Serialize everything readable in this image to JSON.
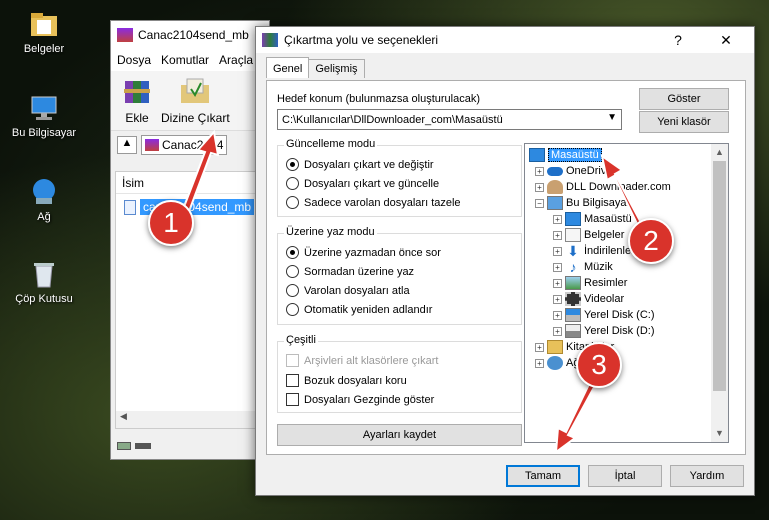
{
  "desktop": {
    "icons": [
      {
        "label": "Belgeler"
      },
      {
        "label": "Bu Bilgisayar"
      },
      {
        "label": "Ağ"
      },
      {
        "label": "Çöp Kutusu"
      }
    ]
  },
  "winrar": {
    "title": "Canac2104send_mb",
    "menu": [
      "Dosya",
      "Komutlar",
      "Araçla"
    ],
    "toolbar": {
      "add": "Ekle",
      "extract_to": "Dizine Çıkart"
    },
    "path": "Canac2104",
    "list_header": "İsim",
    "file": "canac2104send_mb"
  },
  "dialog": {
    "title": "Çıkartma yolu ve seçenekleri",
    "help": "?",
    "close": "✕",
    "tabs": [
      "Genel",
      "Gelişmiş"
    ],
    "destination_label": "Hedef konum (bulunmazsa oluşturulacak)",
    "destination_value": "C:\\Kullanıcılar\\DllDownloader_com\\Masaüstü",
    "show_button": "Göster",
    "new_folder_button": "Yeni klasör",
    "update_mode": {
      "title": "Güncelleme modu",
      "options": [
        "Dosyaları çıkart ve değiştir",
        "Dosyaları çıkart ve güncelle",
        "Sadece varolan dosyaları tazele"
      ],
      "selected": 0
    },
    "overwrite_mode": {
      "title": "Üzerine yaz modu",
      "options": [
        "Üzerine yazmadan önce sor",
        "Sormadan üzerine yaz",
        "Varolan dosyaları atla",
        "Otomatik yeniden adlandır"
      ],
      "selected": 0
    },
    "misc": {
      "title": "Çeşitli",
      "options": [
        "Arşivleri alt klasörlere çıkart",
        "Bozuk dosyaları koru",
        "Dosyaları Gezginde göster"
      ]
    },
    "save_settings": "Ayarları kaydet",
    "tree": [
      {
        "label": "Masaüstü",
        "level": 0,
        "selected": true
      },
      {
        "label": "OneDrive",
        "level": 1
      },
      {
        "label": "DLL Downloader.com",
        "level": 1
      },
      {
        "label": "Bu Bilgisayar",
        "level": 1
      },
      {
        "label": "Masaüstü",
        "level": 2
      },
      {
        "label": "Belgeler",
        "level": 2
      },
      {
        "label": "İndirilenler",
        "level": 2
      },
      {
        "label": "Müzik",
        "level": 2
      },
      {
        "label": "Resimler",
        "level": 2
      },
      {
        "label": "Videolar",
        "level": 2
      },
      {
        "label": "Yerel Disk (C:)",
        "level": 2
      },
      {
        "label": "Yerel Disk (D:)",
        "level": 2
      },
      {
        "label": "Kitaplıklar",
        "level": 1
      },
      {
        "label": "Ağ",
        "level": 1
      }
    ],
    "buttons": {
      "ok": "Tamam",
      "cancel": "İptal",
      "help": "Yardım"
    }
  },
  "annotations": [
    "1",
    "2",
    "3"
  ],
  "colors": {
    "accent": "#0078d7",
    "selection": "#3399ff",
    "annotation": "#d9332b"
  }
}
